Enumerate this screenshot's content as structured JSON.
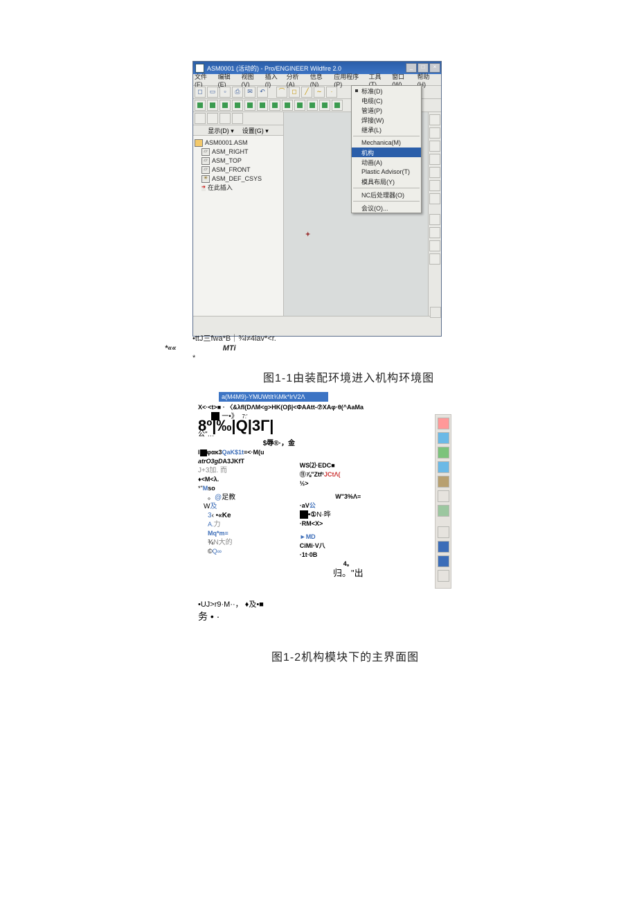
{
  "caption1": "图1-1由装配环境进入机构环境图",
  "caption2": "图1-2机构模块下的主界面图",
  "shot1": {
    "title": "ASM0001 (活动的) - Pro/ENGINEER Wildfire 2.0",
    "menu": [
      "文件(F)",
      "编辑(E)",
      "视图(V)",
      "插入(I)",
      "分析(A)",
      "信息(N)",
      "应用程序(P)",
      "工具(T)",
      "窗口(W)",
      "帮助(H)"
    ],
    "lp_tabs_left": "显示(D) ▾",
    "lp_tabs_right": "设置(G) ▾",
    "tree": {
      "root": "ASM0001.ASM",
      "items": [
        "ASM_RIGHT",
        "ASM_TOP",
        "ASM_FRONT",
        "ASM_DEF_CSYS",
        "在此插入"
      ]
    },
    "dropdown": {
      "items": [
        {
          "label": "标准(D)",
          "bullet": true
        },
        {
          "label": "电缆(C)"
        },
        {
          "label": "管道(P)"
        },
        {
          "label": "焊接(W)"
        },
        {
          "label": "继承(L)"
        },
        {
          "sep": true
        },
        {
          "label": "Mechanica(M)"
        },
        {
          "label": "机构",
          "hl": true
        },
        {
          "label": "动画(A)"
        },
        {
          "label": "Plastic Advisor(T)"
        },
        {
          "label": "模具布局(Y)"
        },
        {
          "sep": true
        },
        {
          "label": "NC后处理器(O)"
        },
        {
          "sep": true
        },
        {
          "label": "会议(O)..."
        }
      ]
    },
    "footerA": "•ttJ三fwa*B｜¾i≠4iav*<r.",
    "footerB": "*«« ",
    "footerC": "MTi",
    "footerD": "*"
  },
  "shot2": {
    "title": "a(M4M9)-YMUWtIt¾Mk*IrV2Λ",
    "line_top": "X<·<t>■ · 〈&λfI(DΛM<g>HK(Oβ|<ΦAAtt-⑦XAφ·θ(^AaMa",
    "line_sq1": "一•》",
    "line_sq1_tail": "7:'",
    "big": "8º|‰|Q|3Γ|",
    "line_under_big": "公\"…",
    "mid_right": "$辱®·，金",
    "row3_left": "I",
    "row3_mid": "φακ3",
    "row3_blue": "QaK$1t",
    "row3_tail": "≡<·M(u",
    "row4_left": "atrO3gD",
    "row4_b": "A3JKfT",
    "row5_left": "J+3",
    "row5_cn": "加. 而",
    "row_right_ws": "WS⑵·EDC■",
    "row_right_11": "⑪⅞\"Ztf¹",
    "row_right_jc": "JCtΛ(",
    "row_right_half": "½>",
    "row6": "♦<M<λ.",
    "row7_a": "*\"",
    "row7_b": "M",
    "row7_c": "so",
    "row_wpct": "W\"3%Λ≡",
    "row_av": "·aV",
    "row_av_cn": "公",
    "row8": "。",
    "row8_blue": "@",
    "row8_cn": "足教",
    "row_sq_one": "•①",
    "row_sq_one_tail": "N·晔",
    "row9": "W",
    "row9_cn": "及",
    "row_rm": "·RM<X>",
    "row10": "3",
    "row10_b": "‹ •",
    "row10_ke": "«Ke",
    "row_md_arrow": "►MD",
    "row11": "A.",
    "row11_cn": "力",
    "row_cimi": "CiMi·V",
    "row_cimi_cn": "八",
    "row12": "Mq*m≡",
    "row_1t": "·1t·0B",
    "row13": "¾",
    "row13_cn": "N大的",
    "row14": "©",
    "row14_b": "Q∞",
    "row_4dot": "4。",
    "row_gui": "归。\"出",
    "bottom1": "•UJ>r9·M··，  ♦及•■",
    "bottom2": "务 • ·"
  }
}
